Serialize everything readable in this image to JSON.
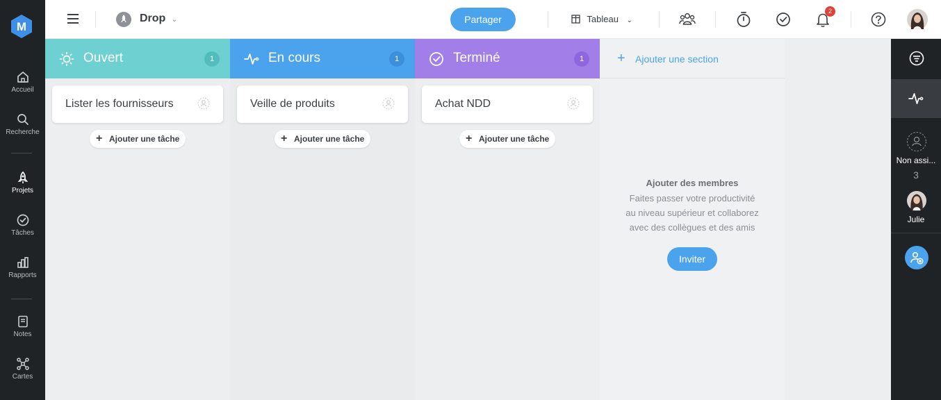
{
  "app": {
    "logo_letter": "M"
  },
  "sidebar": {
    "items": [
      {
        "label": "Accueil",
        "icon": "home-icon"
      },
      {
        "label": "Recherche",
        "icon": "search-icon"
      },
      {
        "label": "Projets",
        "icon": "rocket-icon",
        "active": true
      },
      {
        "label": "Tâches",
        "icon": "check-circle-icon"
      },
      {
        "label": "Rapports",
        "icon": "bar-chart-icon"
      },
      {
        "label": "Notes",
        "icon": "note-icon"
      },
      {
        "label": "Cartes",
        "icon": "mindmap-icon"
      }
    ]
  },
  "header": {
    "project_name": "Drop",
    "share_label": "Partager",
    "view_label": "Tableau",
    "notifications_count": "2"
  },
  "columns": [
    {
      "title": "Ouvert",
      "count": "1",
      "color": "#6fd0d2",
      "card": "Lister les fournisseurs",
      "add_task": "Ajouter une tâche"
    },
    {
      "title": "En cours",
      "count": "1",
      "color": "#4ba3ee",
      "card": "Veille de produits",
      "add_task": "Ajouter une tâche"
    },
    {
      "title": "Terminé",
      "count": "1",
      "color": "#a17ee8",
      "card": "Achat NDD",
      "add_task": "Ajouter une tâche"
    }
  ],
  "add_section": {
    "label": "Ajouter une section"
  },
  "members_prompt": {
    "title": "Ajouter des membres",
    "text": "Faites passer votre productivité au niveau supérieur et collaborez avec des collègues et des amis",
    "invite_label": "Inviter"
  },
  "right_panel": {
    "unassigned_label": "Non assi...",
    "unassigned_count": "3",
    "member_name": "Julie"
  }
}
